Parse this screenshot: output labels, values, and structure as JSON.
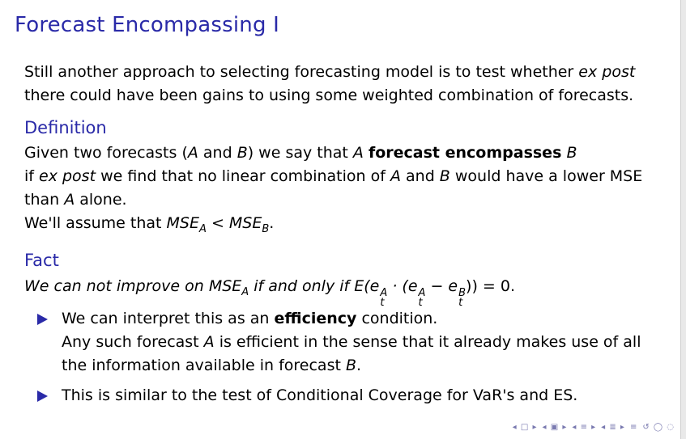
{
  "title": "Forecast Encompassing I",
  "intro": {
    "a": "Still another approach to selecting forecasting model is to test whether ",
    "ex_post": "ex post",
    "b": " there could have been gains to using some weighted combination of forecasts."
  },
  "definition": {
    "heading": "Definition",
    "line1_a": "Given two forecasts (",
    "A": "A",
    "and": " and ",
    "B": "B",
    "line1_b": ") we say that ",
    "bold": "forecast encompasses",
    "line2_a": "if ",
    "ex_post": "ex post",
    "line2_b": " we find that no linear combination of ",
    "line2_c": " would have a lower MSE than ",
    "line2_d": " alone.",
    "line3": "We'll assume that ",
    "mse": "MSE",
    "lt": " < ",
    "period": "."
  },
  "fact": {
    "heading": "Fact",
    "text_a": "We can not improve on ",
    "mse": "MSE",
    "text_b": " if and only if E(e",
    "text_c": " · (e",
    "minus": " − e",
    "end": ")) = 0."
  },
  "bullets": [
    {
      "a": "We can interpret this as an ",
      "bold": "efficiency",
      "b": " condition.",
      "line2_a": "Any such forecast ",
      "line2_b": " is efficient in the sense that it already makes use of all the information available in forecast ",
      "line2_end": "."
    },
    {
      "text": "This is similar to the test of Conditional Coverage for VaR's and ES."
    }
  ],
  "nav_icons": [
    "nav-prev-frame-icon",
    "nav-prev-subsection-icon",
    "nav-prev-section-icon",
    "nav-toc-icon",
    "nav-search-icon"
  ],
  "colors": {
    "title": "#2a2aa8",
    "bullet": "#2a2aa8"
  }
}
